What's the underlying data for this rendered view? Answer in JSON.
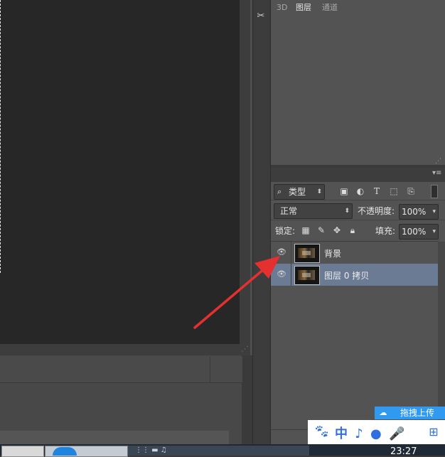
{
  "tools": {
    "tool_icon": "scissors-icon"
  },
  "layers_panel": {
    "tabs": [
      {
        "label": "3D"
      },
      {
        "label": "图层"
      },
      {
        "label": "通道"
      }
    ],
    "filter": {
      "kind_label": "类型",
      "icons": [
        "image-filter-icon",
        "adjustment-filter-icon",
        "type-filter-icon",
        "shape-filter-icon",
        "smart-object-filter-icon"
      ],
      "type_glyph": "T"
    },
    "blend_mode": "正常",
    "opacity_label": "不透明度:",
    "opacity_value": "100%",
    "lock_label": "锁定:",
    "fill_label": "填充:",
    "fill_value": "100%",
    "layers": [
      {
        "name": "背景",
        "visible": true,
        "selected": false
      },
      {
        "name": "图层 0 拷贝",
        "visible": true,
        "selected": true
      }
    ]
  },
  "overlay": {
    "upload_label": "拖拽上传",
    "brand_text": "中 ♪ ● 🎤"
  },
  "taskbar": {
    "clock": "23:27"
  },
  "colors": {
    "selected_layer": "#6b7b94",
    "annotation_arrow": "#e53030",
    "baidu_blue": "#2f6fe0"
  }
}
